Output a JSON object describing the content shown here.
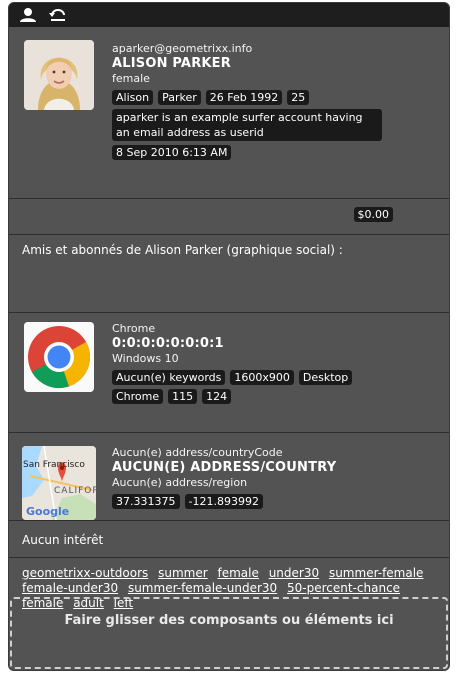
{
  "toolbar": {
    "icons": [
      "user-icon",
      "undo-icon"
    ]
  },
  "profile": {
    "email": "aparker@geometrixx.info",
    "name": "ALISON PARKER",
    "gender": "female",
    "chips": [
      "Alison",
      "Parker",
      "26 Feb 1992",
      "25"
    ],
    "description": "aparker is an example surfer account having an email address as userid",
    "date": "8 Sep 2010 6:13 AM"
  },
  "balance": {
    "amount": "$0.00"
  },
  "friends": {
    "text": "Amis et abonnés de Alison Parker (graphique social) :"
  },
  "browser": {
    "name": "Chrome",
    "ip": "0:0:0:0:0:0:0:1",
    "os": "Windows 10",
    "chips_row1": [
      "Aucun(e) keywords",
      "1600x900",
      "Desktop"
    ],
    "chips_row2": [
      "Chrome",
      "115",
      "124"
    ]
  },
  "geo": {
    "country_code": "Aucun(e) address/countryCode",
    "country": "AUCUN(E) ADDRESS/COUNTRY",
    "region": "Aucun(e) address/region",
    "lat": "37.331375",
    "lng": "-121.893992",
    "map_city": "San Francisco",
    "map_state": "CALIFOR",
    "map_brand": "Google"
  },
  "interest": {
    "text": "Aucun intérêt"
  },
  "tags": [
    "geometrixx-outdoors",
    "summer",
    "female",
    "under30",
    "summer-female",
    "female-under30",
    "summer-female-under30",
    "50-percent-chance",
    "female",
    "adult",
    "left"
  ],
  "dropzone": {
    "text": "Faire glisser des composants ou éléments ici"
  }
}
